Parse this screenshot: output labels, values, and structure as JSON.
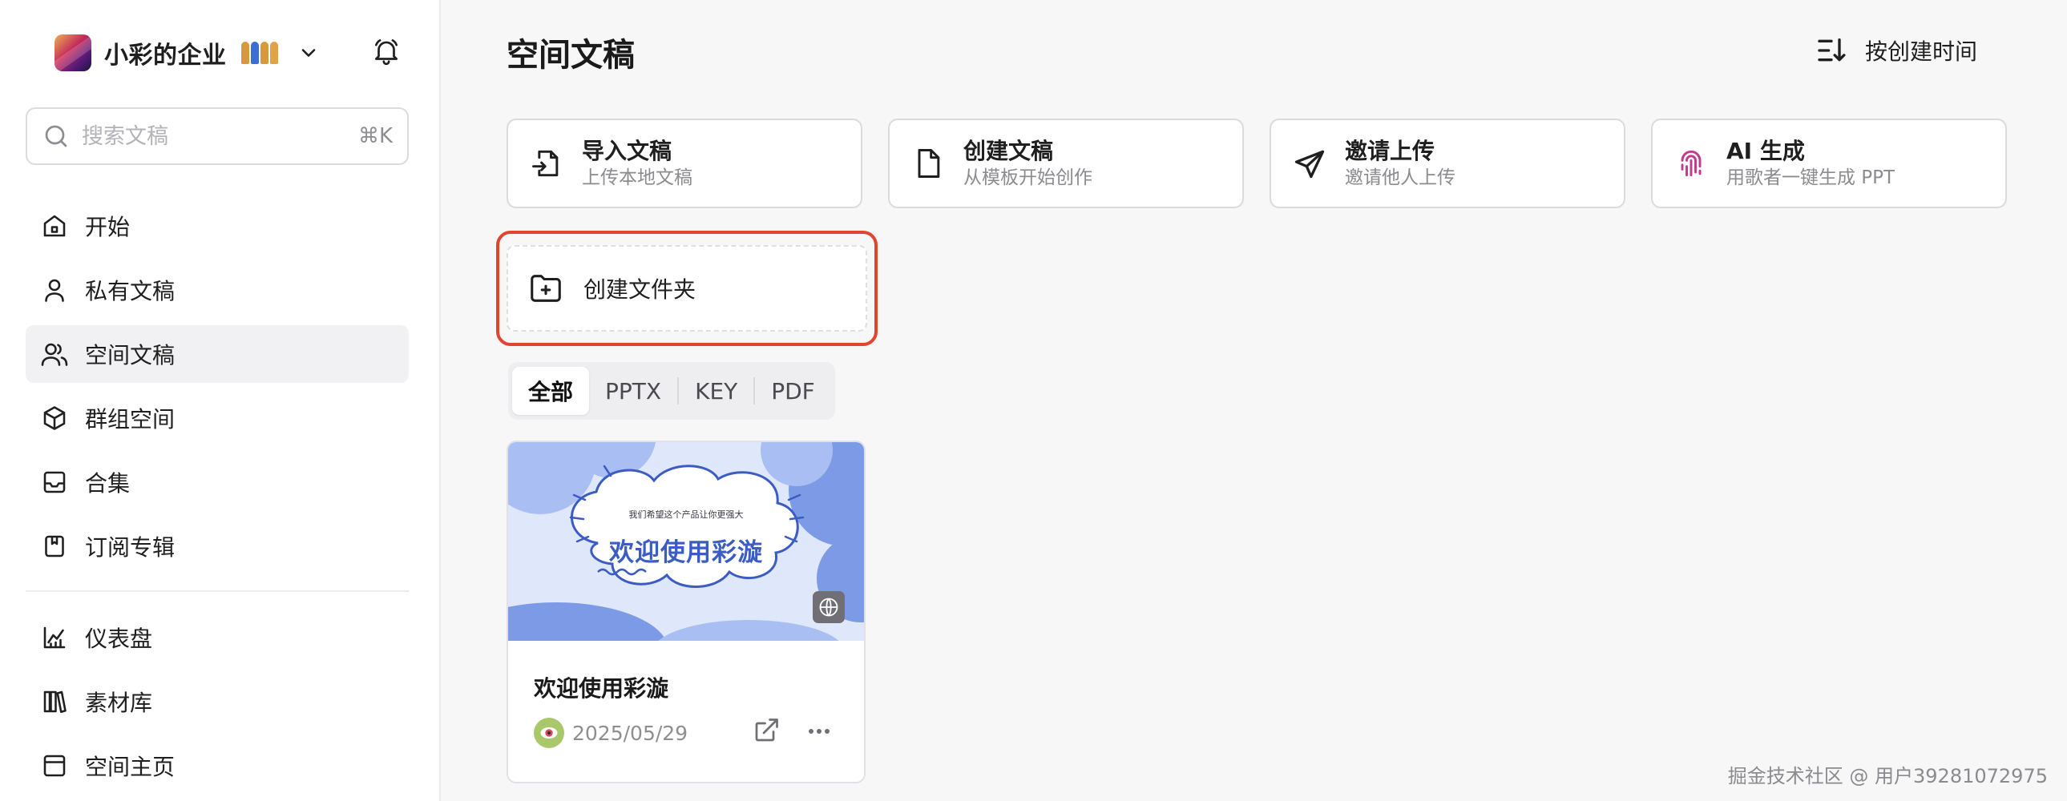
{
  "sidebar": {
    "org_name": "小彩的企业",
    "org_emoji_icon": "couple-emoji",
    "search": {
      "placeholder": "搜索文稿",
      "shortcut": "⌘K"
    },
    "nav_primary": [
      {
        "label": "开始",
        "icon": "home-icon"
      },
      {
        "label": "私有文稿",
        "icon": "user-icon"
      },
      {
        "label": "空间文稿",
        "icon": "users-icon",
        "active": true
      },
      {
        "label": "群组空间",
        "icon": "cube-icon"
      },
      {
        "label": "合集",
        "icon": "inbox-icon"
      },
      {
        "label": "订阅专辑",
        "icon": "bookmark-icon"
      }
    ],
    "nav_secondary": [
      {
        "label": "仪表盘",
        "icon": "chart-icon"
      },
      {
        "label": "素材库",
        "icon": "library-icon"
      },
      {
        "label": "空间主页",
        "icon": "window-icon"
      }
    ]
  },
  "main": {
    "title": "空间文稿",
    "sort_label": "按创建时间",
    "actions": [
      {
        "title": "导入文稿",
        "subtitle": "上传本地文稿",
        "icon": "import-file-icon"
      },
      {
        "title": "创建文稿",
        "subtitle": "从模板开始创作",
        "icon": "new-file-icon"
      },
      {
        "title": "邀请上传",
        "subtitle": "邀请他人上传",
        "icon": "send-icon"
      },
      {
        "title": "AI 生成",
        "subtitle": "用歌者一键生成 PPT",
        "icon": "ai-fingerprint-icon"
      }
    ],
    "create_folder_label": "创建文件夹",
    "filters": [
      {
        "label": "全部",
        "active": true
      },
      {
        "label": "PPTX"
      },
      {
        "label": "KEY"
      },
      {
        "label": "PDF"
      }
    ],
    "documents": [
      {
        "name": "欢迎使用彩漩",
        "date": "2025/05/29",
        "thumbnail_title": "欢迎使用彩漩",
        "thumbnail_tagline": "我们希望这个产品让你更强大"
      }
    ]
  },
  "watermark": "掘金技术社区 @ 用户39281072975",
  "colors": {
    "accent_highlight": "#e2452f",
    "thumbnail_blue": "#3b5cc4",
    "sidebar_active_bg": "#f1f1f3"
  }
}
